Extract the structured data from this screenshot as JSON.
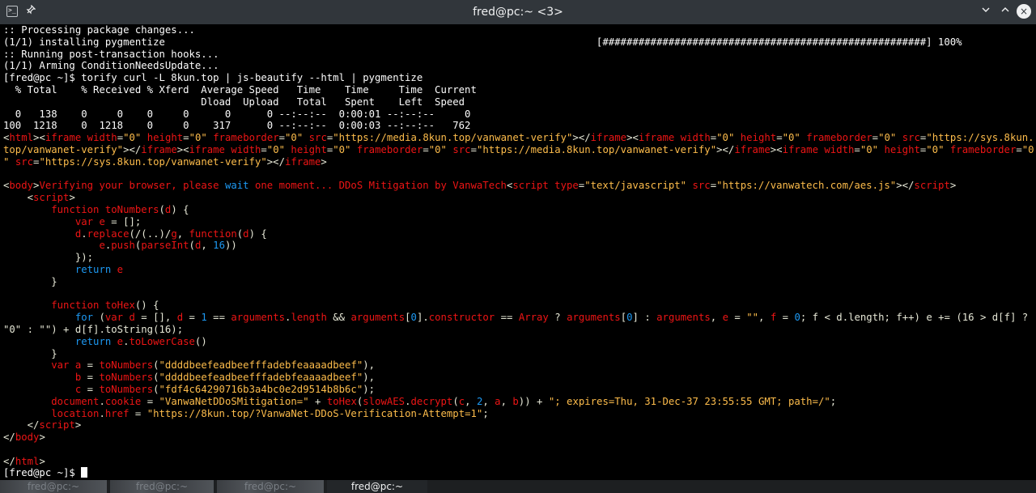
{
  "window": {
    "title": "fred@pc:~ <3>",
    "app_icon_glyph": ">_",
    "buttons": {
      "minimize": "∨",
      "maximize": "∧",
      "close": "×",
      "pin": "📌"
    }
  },
  "terminal": {
    "lines": [
      [
        {
          "c": "pr",
          "t": ":: Processing package changes..."
        }
      ],
      [
        {
          "c": "pr",
          "t": "(1/1) installing pygmentize                                                                        [######################################################] 100%"
        }
      ],
      [
        {
          "c": "pr",
          "t": ":: Running post-transaction hooks..."
        }
      ],
      [
        {
          "c": "pr",
          "t": "(1/1) Arming ConditionNeedsUpdate..."
        }
      ],
      [
        {
          "c": "pr",
          "t": "[fred@pc ~]$ torify curl -L 8kun.top | js-beautify --html | pygmentize"
        }
      ],
      [
        {
          "c": "pr",
          "t": "  % Total    % Received % Xferd  Average Speed   Time    Time     Time  Current"
        }
      ],
      [
        {
          "c": "pr",
          "t": "                                 Dload  Upload   Total   Spent    Left  Speed"
        }
      ],
      [
        {
          "c": "pr",
          "t": "  0   138    0     0    0     0      0      0 --:--:--  0:00:01 --:--:--     0"
        }
      ],
      [
        {
          "c": "pr",
          "t": "100  1218    0  1218    0     0    317      0 --:--:--  0:00:03 --:--:--   762"
        }
      ],
      [
        {
          "c": "p",
          "t": "<"
        },
        {
          "c": "r",
          "t": "html"
        },
        {
          "c": "p",
          "t": ">"
        },
        {
          "c": "p",
          "t": "<"
        },
        {
          "c": "r",
          "t": "iframe"
        },
        {
          "c": "p",
          "t": " "
        },
        {
          "c": "r",
          "t": "width"
        },
        {
          "c": "p",
          "t": "="
        },
        {
          "c": "y",
          "t": "\"0\""
        },
        {
          "c": "p",
          "t": " "
        },
        {
          "c": "r",
          "t": "height"
        },
        {
          "c": "p",
          "t": "="
        },
        {
          "c": "y",
          "t": "\"0\""
        },
        {
          "c": "p",
          "t": " "
        },
        {
          "c": "r",
          "t": "frameborder"
        },
        {
          "c": "p",
          "t": "="
        },
        {
          "c": "y",
          "t": "\"0\""
        },
        {
          "c": "p",
          "t": " "
        },
        {
          "c": "r",
          "t": "src"
        },
        {
          "c": "p",
          "t": "="
        },
        {
          "c": "y",
          "t": "\"https://media.8kun.top/vanwanet-verify\""
        },
        {
          "c": "p",
          "t": "></"
        },
        {
          "c": "r",
          "t": "iframe"
        },
        {
          "c": "p",
          "t": "><"
        },
        {
          "c": "r",
          "t": "iframe"
        },
        {
          "c": "p",
          "t": " "
        },
        {
          "c": "r",
          "t": "width"
        },
        {
          "c": "p",
          "t": "="
        },
        {
          "c": "y",
          "t": "\"0\""
        },
        {
          "c": "p",
          "t": " "
        },
        {
          "c": "r",
          "t": "height"
        },
        {
          "c": "p",
          "t": "="
        },
        {
          "c": "y",
          "t": "\"0\""
        },
        {
          "c": "p",
          "t": " "
        },
        {
          "c": "r",
          "t": "frameborder"
        },
        {
          "c": "p",
          "t": "="
        },
        {
          "c": "y",
          "t": "\"0\""
        },
        {
          "c": "p",
          "t": " "
        },
        {
          "c": "r",
          "t": "src"
        },
        {
          "c": "p",
          "t": "="
        },
        {
          "c": "y",
          "t": "\"https://sys.8kun."
        }
      ],
      [
        {
          "c": "y",
          "t": "top/vanwanet-verify\""
        },
        {
          "c": "p",
          "t": "></"
        },
        {
          "c": "r",
          "t": "iframe"
        },
        {
          "c": "p",
          "t": "><"
        },
        {
          "c": "r",
          "t": "iframe"
        },
        {
          "c": "p",
          "t": " "
        },
        {
          "c": "r",
          "t": "width"
        },
        {
          "c": "p",
          "t": "="
        },
        {
          "c": "y",
          "t": "\"0\""
        },
        {
          "c": "p",
          "t": " "
        },
        {
          "c": "r",
          "t": "height"
        },
        {
          "c": "p",
          "t": "="
        },
        {
          "c": "y",
          "t": "\"0\""
        },
        {
          "c": "p",
          "t": " "
        },
        {
          "c": "r",
          "t": "frameborder"
        },
        {
          "c": "p",
          "t": "="
        },
        {
          "c": "y",
          "t": "\"0\""
        },
        {
          "c": "p",
          "t": " "
        },
        {
          "c": "r",
          "t": "src"
        },
        {
          "c": "p",
          "t": "="
        },
        {
          "c": "y",
          "t": "\"https://media.8kun.top/vanwanet-verify\""
        },
        {
          "c": "p",
          "t": "></"
        },
        {
          "c": "r",
          "t": "iframe"
        },
        {
          "c": "p",
          "t": "><"
        },
        {
          "c": "r",
          "t": "iframe"
        },
        {
          "c": "p",
          "t": " "
        },
        {
          "c": "r",
          "t": "width"
        },
        {
          "c": "p",
          "t": "="
        },
        {
          "c": "y",
          "t": "\"0\""
        },
        {
          "c": "p",
          "t": " "
        },
        {
          "c": "r",
          "t": "height"
        },
        {
          "c": "p",
          "t": "="
        },
        {
          "c": "y",
          "t": "\"0\""
        },
        {
          "c": "p",
          "t": " "
        },
        {
          "c": "r",
          "t": "frameborder"
        },
        {
          "c": "p",
          "t": "="
        },
        {
          "c": "y",
          "t": "\"0"
        }
      ],
      [
        {
          "c": "y",
          "t": "\""
        },
        {
          "c": "p",
          "t": " "
        },
        {
          "c": "r",
          "t": "src"
        },
        {
          "c": "p",
          "t": "="
        },
        {
          "c": "y",
          "t": "\"https://sys.8kun.top/vanwanet-verify\""
        },
        {
          "c": "p",
          "t": "></"
        },
        {
          "c": "r",
          "t": "iframe"
        },
        {
          "c": "p",
          "t": ">"
        }
      ],
      [
        {
          "c": "p",
          "t": " "
        }
      ],
      [
        {
          "c": "p",
          "t": "<"
        },
        {
          "c": "r",
          "t": "body"
        },
        {
          "c": "p",
          "t": ">"
        },
        {
          "c": "r",
          "t": "Verifying your browser, please "
        },
        {
          "c": "b",
          "t": "wait"
        },
        {
          "c": "r",
          "t": " one moment... DDoS Mitigation by VanwaTech"
        },
        {
          "c": "p",
          "t": "<"
        },
        {
          "c": "r",
          "t": "script"
        },
        {
          "c": "p",
          "t": " "
        },
        {
          "c": "r",
          "t": "type"
        },
        {
          "c": "p",
          "t": "="
        },
        {
          "c": "y",
          "t": "\"text/javascript\""
        },
        {
          "c": "p",
          "t": " "
        },
        {
          "c": "r",
          "t": "src"
        },
        {
          "c": "p",
          "t": "="
        },
        {
          "c": "y",
          "t": "\"https://vanwatech.com/aes.js\""
        },
        {
          "c": "p",
          "t": "></"
        },
        {
          "c": "r",
          "t": "script"
        },
        {
          "c": "p",
          "t": ">"
        }
      ],
      [
        {
          "c": "p",
          "t": "    <"
        },
        {
          "c": "r",
          "t": "script"
        },
        {
          "c": "p",
          "t": ">"
        }
      ],
      [
        {
          "c": "p",
          "t": "        "
        },
        {
          "c": "r",
          "t": "function"
        },
        {
          "c": "p",
          "t": " "
        },
        {
          "c": "r",
          "t": "toNumbers"
        },
        {
          "c": "p",
          "t": "("
        },
        {
          "c": "r",
          "t": "d"
        },
        {
          "c": "p",
          "t": ") {"
        }
      ],
      [
        {
          "c": "p",
          "t": "            "
        },
        {
          "c": "r",
          "t": "var"
        },
        {
          "c": "p",
          "t": " "
        },
        {
          "c": "r",
          "t": "e"
        },
        {
          "c": "p",
          "t": " = [];"
        }
      ],
      [
        {
          "c": "p",
          "t": "            "
        },
        {
          "c": "r",
          "t": "d"
        },
        {
          "c": "p",
          "t": "."
        },
        {
          "c": "r",
          "t": "replace"
        },
        {
          "c": "p",
          "t": "(/(..)/"
        },
        {
          "c": "r",
          "t": "g"
        },
        {
          "c": "p",
          "t": ", "
        },
        {
          "c": "r",
          "t": "function"
        },
        {
          "c": "p",
          "t": "("
        },
        {
          "c": "r",
          "t": "d"
        },
        {
          "c": "p",
          "t": ") {"
        }
      ],
      [
        {
          "c": "p",
          "t": "                "
        },
        {
          "c": "r",
          "t": "e"
        },
        {
          "c": "p",
          "t": "."
        },
        {
          "c": "r",
          "t": "push"
        },
        {
          "c": "p",
          "t": "("
        },
        {
          "c": "r",
          "t": "parseInt"
        },
        {
          "c": "p",
          "t": "("
        },
        {
          "c": "r",
          "t": "d"
        },
        {
          "c": "p",
          "t": ", "
        },
        {
          "c": "b",
          "t": "16"
        },
        {
          "c": "p",
          "t": "))"
        }
      ],
      [
        {
          "c": "p",
          "t": "            });"
        }
      ],
      [
        {
          "c": "p",
          "t": "            "
        },
        {
          "c": "b",
          "t": "return"
        },
        {
          "c": "p",
          "t": " "
        },
        {
          "c": "r",
          "t": "e"
        }
      ],
      [
        {
          "c": "p",
          "t": "        }"
        }
      ],
      [
        {
          "c": "p",
          "t": " "
        }
      ],
      [
        {
          "c": "p",
          "t": "        "
        },
        {
          "c": "r",
          "t": "function"
        },
        {
          "c": "p",
          "t": " "
        },
        {
          "c": "r",
          "t": "toHex"
        },
        {
          "c": "p",
          "t": "() {"
        }
      ],
      [
        {
          "c": "p",
          "t": "            "
        },
        {
          "c": "b",
          "t": "for"
        },
        {
          "c": "p",
          "t": " ("
        },
        {
          "c": "r",
          "t": "var"
        },
        {
          "c": "p",
          "t": " "
        },
        {
          "c": "r",
          "t": "d"
        },
        {
          "c": "p",
          "t": " = [], "
        },
        {
          "c": "r",
          "t": "d"
        },
        {
          "c": "p",
          "t": " = "
        },
        {
          "c": "b",
          "t": "1"
        },
        {
          "c": "p",
          "t": " == "
        },
        {
          "c": "r",
          "t": "arguments"
        },
        {
          "c": "p",
          "t": "."
        },
        {
          "c": "r",
          "t": "length"
        },
        {
          "c": "p",
          "t": " && "
        },
        {
          "c": "r",
          "t": "arguments"
        },
        {
          "c": "p",
          "t": "["
        },
        {
          "c": "b",
          "t": "0"
        },
        {
          "c": "p",
          "t": "]."
        },
        {
          "c": "r",
          "t": "constructor"
        },
        {
          "c": "p",
          "t": " == "
        },
        {
          "c": "r",
          "t": "Array"
        },
        {
          "c": "p",
          "t": " ? "
        },
        {
          "c": "r",
          "t": "arguments"
        },
        {
          "c": "p",
          "t": "["
        },
        {
          "c": "b",
          "t": "0"
        },
        {
          "c": "p",
          "t": "] : "
        },
        {
          "c": "r",
          "t": "arguments"
        },
        {
          "c": "p",
          "t": ", "
        },
        {
          "c": "r",
          "t": "e"
        },
        {
          "c": "p",
          "t": " = "
        },
        {
          "c": "y",
          "t": "\"\""
        },
        {
          "c": "p",
          "t": ", "
        },
        {
          "c": "r",
          "t": "f"
        },
        {
          "c": "p",
          "t": " = "
        },
        {
          "c": "b",
          "t": "0"
        },
        {
          "c": "p",
          "t": "; f < d.length; f++) e += (16 > d[f] ?"
        }
      ],
      [
        {
          "c": "p",
          "t": "\"0\" : \"\") + d[f].toString(16);"
        }
      ],
      [
        {
          "c": "p",
          "t": "            "
        },
        {
          "c": "b",
          "t": "return"
        },
        {
          "c": "p",
          "t": " "
        },
        {
          "c": "r",
          "t": "e"
        },
        {
          "c": "p",
          "t": "."
        },
        {
          "c": "r",
          "t": "toLowerCase"
        },
        {
          "c": "p",
          "t": "()"
        }
      ],
      [
        {
          "c": "p",
          "t": "        }"
        }
      ],
      [
        {
          "c": "p",
          "t": "        "
        },
        {
          "c": "r",
          "t": "var"
        },
        {
          "c": "p",
          "t": " "
        },
        {
          "c": "r",
          "t": "a"
        },
        {
          "c": "p",
          "t": " = "
        },
        {
          "c": "r",
          "t": "toNumbers"
        },
        {
          "c": "p",
          "t": "("
        },
        {
          "c": "y",
          "t": "\"ddddbeefeadbeefffadebfeaaaadbeef\""
        },
        {
          "c": "p",
          "t": "),"
        }
      ],
      [
        {
          "c": "p",
          "t": "            "
        },
        {
          "c": "r",
          "t": "b"
        },
        {
          "c": "p",
          "t": " = "
        },
        {
          "c": "r",
          "t": "toNumbers"
        },
        {
          "c": "p",
          "t": "("
        },
        {
          "c": "y",
          "t": "\"ddddbeefeadbeefffadebfeaaaadbeef\""
        },
        {
          "c": "p",
          "t": "),"
        }
      ],
      [
        {
          "c": "p",
          "t": "            "
        },
        {
          "c": "r",
          "t": "c"
        },
        {
          "c": "p",
          "t": " = "
        },
        {
          "c": "r",
          "t": "toNumbers"
        },
        {
          "c": "p",
          "t": "("
        },
        {
          "c": "y",
          "t": "\"fdf4c64290716b3a4bc0e2d9514b8b6c\""
        },
        {
          "c": "p",
          "t": ");"
        }
      ],
      [
        {
          "c": "p",
          "t": "        "
        },
        {
          "c": "r",
          "t": "document"
        },
        {
          "c": "p",
          "t": "."
        },
        {
          "c": "r",
          "t": "cookie"
        },
        {
          "c": "p",
          "t": " = "
        },
        {
          "c": "y",
          "t": "\"VanwaNetDDoSMitigation=\""
        },
        {
          "c": "p",
          "t": " + "
        },
        {
          "c": "r",
          "t": "toHex"
        },
        {
          "c": "p",
          "t": "("
        },
        {
          "c": "r",
          "t": "slowAES"
        },
        {
          "c": "p",
          "t": "."
        },
        {
          "c": "r",
          "t": "decrypt"
        },
        {
          "c": "p",
          "t": "("
        },
        {
          "c": "r",
          "t": "c"
        },
        {
          "c": "p",
          "t": ", "
        },
        {
          "c": "b",
          "t": "2"
        },
        {
          "c": "p",
          "t": ", "
        },
        {
          "c": "r",
          "t": "a"
        },
        {
          "c": "p",
          "t": ", "
        },
        {
          "c": "r",
          "t": "b"
        },
        {
          "c": "p",
          "t": ")) + "
        },
        {
          "c": "y",
          "t": "\"; expires=Thu, 31-Dec-37 23:55:55 GMT; path=/\""
        },
        {
          "c": "p",
          "t": ";"
        }
      ],
      [
        {
          "c": "p",
          "t": "        "
        },
        {
          "c": "r",
          "t": "location"
        },
        {
          "c": "p",
          "t": "."
        },
        {
          "c": "r",
          "t": "href"
        },
        {
          "c": "p",
          "t": " = "
        },
        {
          "c": "y",
          "t": "\"https://8kun.top/?VanwaNet-DDoS-Verification-Attempt=1\""
        },
        {
          "c": "p",
          "t": ";"
        }
      ],
      [
        {
          "c": "p",
          "t": "    </"
        },
        {
          "c": "r",
          "t": "script"
        },
        {
          "c": "p",
          "t": ">"
        }
      ],
      [
        {
          "c": "p",
          "t": "</"
        },
        {
          "c": "r",
          "t": "body"
        },
        {
          "c": "p",
          "t": ">"
        }
      ],
      [
        {
          "c": "p",
          "t": " "
        }
      ],
      [
        {
          "c": "p",
          "t": "</"
        },
        {
          "c": "r",
          "t": "html"
        },
        {
          "c": "p",
          "t": ">"
        }
      ],
      [
        {
          "c": "pr",
          "t": "[fred@pc ~]$ "
        }
      ]
    ]
  },
  "tabs": [
    {
      "label": "fred@pc:~",
      "active": false
    },
    {
      "label": "fred@pc:~",
      "active": false
    },
    {
      "label": "fred@pc:~",
      "active": false
    },
    {
      "label": "fred@pc:~",
      "active": true
    }
  ],
  "colors": {
    "titlebar": "#31363b",
    "terminal_bg": "#000000",
    "tag_red": "#ed1515",
    "string_yellow": "#fdbc4b",
    "keyword_blue": "#1d99f3"
  }
}
